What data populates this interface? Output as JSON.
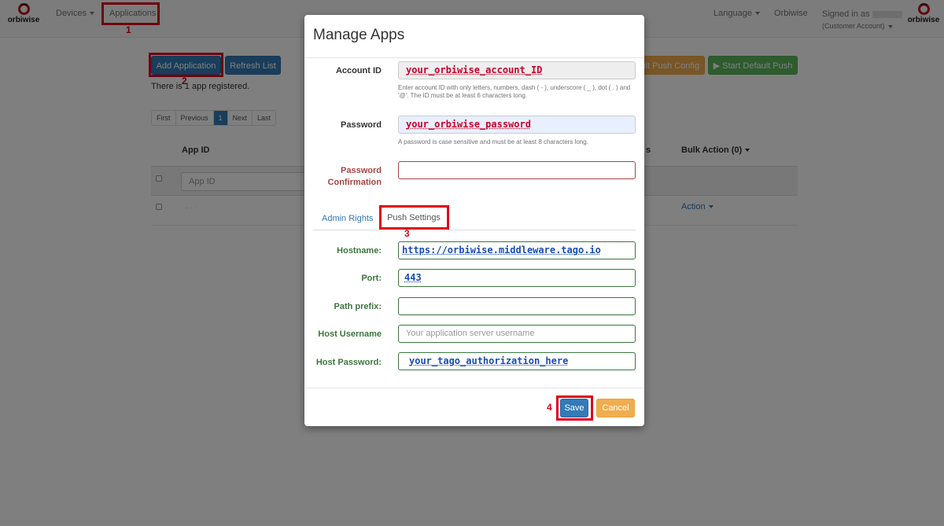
{
  "navbar": {
    "brand": "orbiwise",
    "devices": "Devices",
    "applications": "Applications",
    "language": "Language",
    "orbiwise_link": "Orbiwise",
    "signed_in_as": "Signed in as",
    "account_type": "(Customer Account)"
  },
  "toolbar": {
    "add_application": "Add Application",
    "refresh_list": "Refresh List",
    "default_push_config": "ult Push Config",
    "start_default_push": "▶ Start Default Push",
    "app_count_text": "There is 1 app registered."
  },
  "pagination": {
    "first": "First",
    "previous": "Previous",
    "current": "1",
    "next": "Next",
    "last": "Last"
  },
  "table": {
    "col_app_id": "App ID",
    "col_status_fragment": "s",
    "col_bulk_action": "Bulk Action (0)",
    "filter_placeholder": "App ID",
    "row_id": "· · ·",
    "row_action": "Action"
  },
  "modal": {
    "title": "Manage Apps",
    "account_id": {
      "label": "Account ID",
      "value": "your_orbiwise_account_ID",
      "help": "Enter account ID with only letters, numbers, dash ( - ), underscore ( _ ), dot ( . ) and '@'. The ID must be at least 6 characters long."
    },
    "password": {
      "label": "Password",
      "value": "your_orbiwise_password",
      "help": "A password is case sensitive and must be at least 8 characters long."
    },
    "password_confirmation": {
      "label_line1": "Password",
      "label_line2": "Confirmation",
      "value": ""
    },
    "tabs": {
      "admin_rights": "Admin Rights",
      "push_settings": "Push Settings"
    },
    "hostname": {
      "label": "Hostname:",
      "value": "https://orbiwise.middleware.tago.io"
    },
    "port": {
      "label": "Port:",
      "value": "443"
    },
    "path_prefix": {
      "label": "Path prefix:",
      "value": ""
    },
    "host_username": {
      "label": "Host Username",
      "placeholder": "Your application server username"
    },
    "host_password": {
      "label": "Host Password:",
      "value": "your_tago_authorization_here"
    },
    "save": "Save",
    "cancel": "Cancel"
  },
  "annotations": {
    "step1": "1",
    "step2": "2",
    "step3": "3",
    "step4": "4"
  },
  "colors": {
    "primary": "#337ab7",
    "warning": "#f0ad4e",
    "success": "#5cb85c",
    "error": "#a94442",
    "valid": "#3c763d",
    "annotation": "#e0001b"
  }
}
